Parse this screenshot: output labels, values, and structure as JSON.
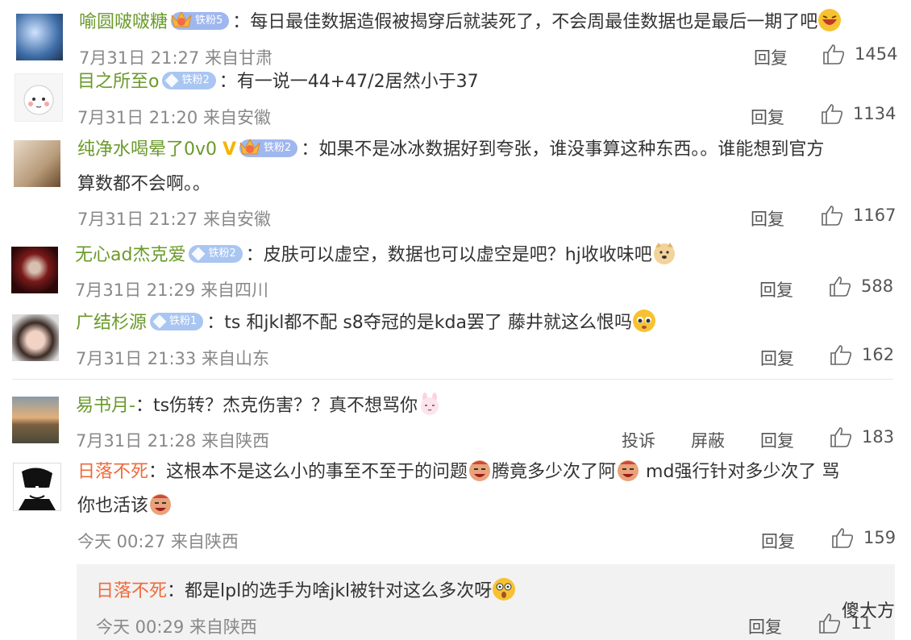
{
  "comments": [
    {
      "name": "喻圆啵啵糖",
      "badge": "铁粉5",
      "text": "：每日最佳数据造假被揭穿后就装死了，不会周最佳数据也是最后一期了吧",
      "meta": "7月31日 21:27 来自甘肃",
      "reply": "回复",
      "likes": "1454"
    },
    {
      "name": "目之所至o",
      "badge": "铁粉2",
      "text": "：有一说一44+47/2居然小于37",
      "meta": "7月31日 21:20 来自安徽",
      "reply": "回复",
      "likes": "1134"
    },
    {
      "name": "纯净水喝晕了0v0",
      "badge": "铁粉2",
      "text_line1": "：如果不是冰冰数据好到夸张，谁没事算这种东西。。谁能想到官方",
      "text_line2": "算数都不会啊。。",
      "meta": "7月31日 21:27 来自安徽",
      "reply": "回复",
      "likes": "1167"
    },
    {
      "name": "无心ad杰克爱",
      "badge": "铁粉2",
      "text": "：皮肤可以虚空，数据也可以虚空是吧？hj收收味吧",
      "meta": "7月31日 21:29 来自四川",
      "reply": "回复",
      "likes": "588"
    },
    {
      "name": "广结杉源",
      "badge": "铁粉1",
      "text": "：ts 和jkl都不配 s8夺冠的是kda罢了 藤井就这么恨吗",
      "meta": "7月31日 21:33 来自山东",
      "reply": "回复",
      "likes": "162"
    },
    {
      "name": "易书月-",
      "text": "：ts伤转？杰克伤害？？真不想骂你",
      "meta": "7月31日 21:28 来自陕西",
      "complain": "投诉",
      "block": "屏蔽",
      "reply": "回复",
      "likes": "183"
    },
    {
      "name": "日落不死",
      "text_line1": "：这根本不是这么小的事至不至于的问题",
      "text_line1b": "腾竟多少次了阿",
      "text_line1c": " md强行针对多少次了 骂",
      "text_line2": "你也活该",
      "meta": "今天 00:27 来自陕西",
      "reply": "回复",
      "likes": "159"
    }
  ],
  "sub_reply": {
    "name": "日落不死",
    "text": "：都是lpl的选手为啥jkl被针对这么多次呀",
    "meta": "今天 00:29 来自陕西",
    "reply": "回复",
    "likes": "11"
  },
  "watermark": "傻大方"
}
